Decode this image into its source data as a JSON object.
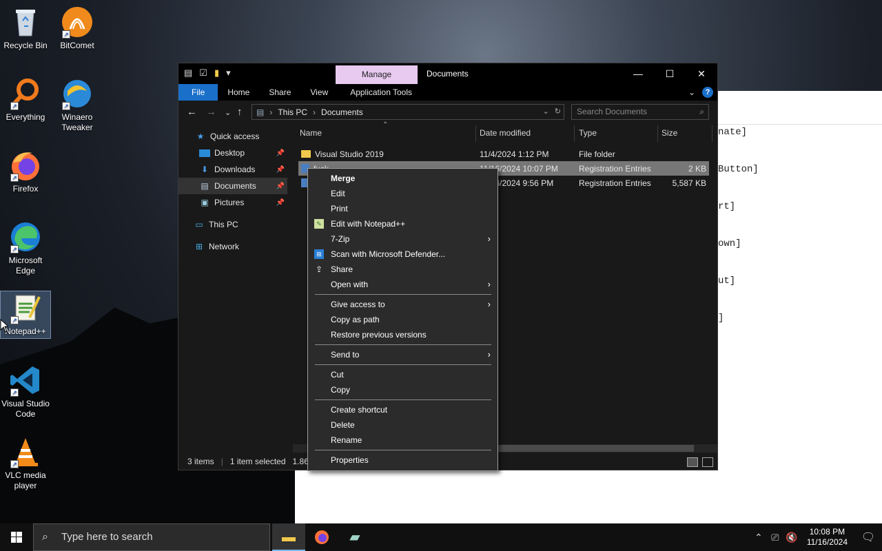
{
  "desktop": {
    "icons": [
      {
        "label": "Recycle Bin"
      },
      {
        "label": "BitComet"
      },
      {
        "label": "Everything"
      },
      {
        "label": "Winaero Tweaker"
      },
      {
        "label": "Firefox"
      },
      {
        "label": "Microsoft Edge"
      },
      {
        "label": "Notepad++"
      },
      {
        "label": "Visual Studio Code"
      },
      {
        "label": "VLC media player"
      }
    ]
  },
  "notepad_bg": {
    "lines": [
      "nate]",
      "Button]",
      "rt]",
      "own]",
      "ut]",
      "]"
    ]
  },
  "explorer": {
    "manage_tab": "Manage",
    "title": "Documents",
    "window_buttons": {
      "minimize": "—",
      "maximize": "☐",
      "close": "✕"
    },
    "ribbon_tabs": [
      "File",
      "Home",
      "Share",
      "View",
      "Application Tools"
    ],
    "address": {
      "root": "This PC",
      "current": "Documents"
    },
    "search_placeholder": "Search Documents",
    "nav": {
      "quick_access": "Quick access",
      "desktop": "Desktop",
      "downloads": "Downloads",
      "documents": "Documents",
      "pictures": "Pictures",
      "this_pc": "This PC",
      "network": "Network"
    },
    "columns": {
      "name": "Name",
      "date": "Date modified",
      "type": "Type",
      "size": "Size"
    },
    "files": [
      {
        "name": "Visual Studio 2019",
        "date": "11/4/2024 1:12 PM",
        "type": "File folder",
        "size": "",
        "kind": "folder"
      },
      {
        "name": "fuck",
        "date": "11/16/2024 10:07 PM",
        "type": "Registration Entries",
        "size": "2 KB",
        "kind": "reg"
      },
      {
        "name": "",
        "date": "11/16/2024 9:56 PM",
        "type": "Registration Entries",
        "size": "5,587 KB",
        "kind": "reg"
      }
    ],
    "status": {
      "items": "3 items",
      "selected": "1 item selected",
      "size": "1.86 K"
    }
  },
  "context_menu": {
    "merge": "Merge",
    "edit": "Edit",
    "print": "Print",
    "edit_npp": "Edit with Notepad++",
    "zip": "7-Zip",
    "defender": "Scan with Microsoft Defender...",
    "share": "Share",
    "open_with": "Open with",
    "give_access": "Give access to",
    "copy_path": "Copy as path",
    "restore": "Restore previous versions",
    "send_to": "Send to",
    "cut": "Cut",
    "copy": "Copy",
    "create_shortcut": "Create shortcut",
    "delete": "Delete",
    "rename": "Rename",
    "properties": "Properties"
  },
  "taskbar": {
    "search_placeholder": "Type here to search",
    "time": "10:08 PM",
    "date": "11/16/2024"
  }
}
